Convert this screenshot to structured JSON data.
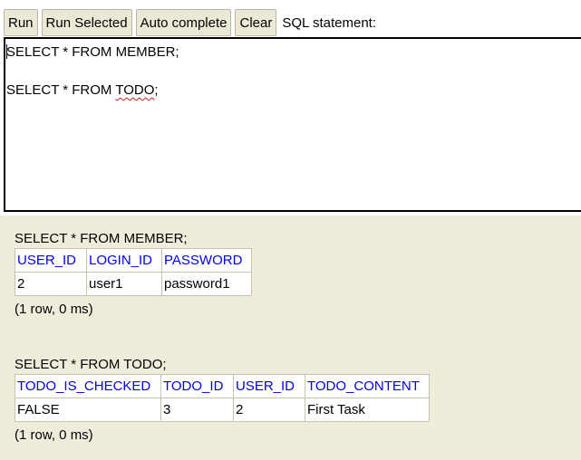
{
  "toolbar": {
    "run_label": "Run",
    "run_selected_label": "Run Selected",
    "auto_complete_label": "Auto complete",
    "clear_label": "Clear",
    "sql_statement_label": "SQL statement:"
  },
  "editor": {
    "lines": [
      "SELECT * FROM MEMBER;",
      "",
      "SELECT * FROM "
    ],
    "misspelled_word": "TODO",
    "line3_suffix": ";"
  },
  "results": [
    {
      "statement": "SELECT * FROM MEMBER;",
      "columns": [
        "USER_ID",
        "LOGIN_ID",
        "PASSWORD"
      ],
      "rows": [
        [
          "2",
          "user1",
          "password1"
        ]
      ],
      "meta": "(1 row, 0 ms)"
    },
    {
      "statement": "SELECT * FROM TODO;",
      "columns": [
        "TODO_IS_CHECKED",
        "TODO_ID",
        "USER_ID",
        "TODO_CONTENT"
      ],
      "rows": [
        [
          "FALSE",
          "3",
          "2",
          "First Task"
        ]
      ],
      "meta": "(1 row, 0 ms)"
    }
  ],
  "colors": {
    "background": "#f0ecdc",
    "button_bg": "#ece8d6",
    "header_link": "#0000ee",
    "spell_error": "#d21c1c"
  }
}
